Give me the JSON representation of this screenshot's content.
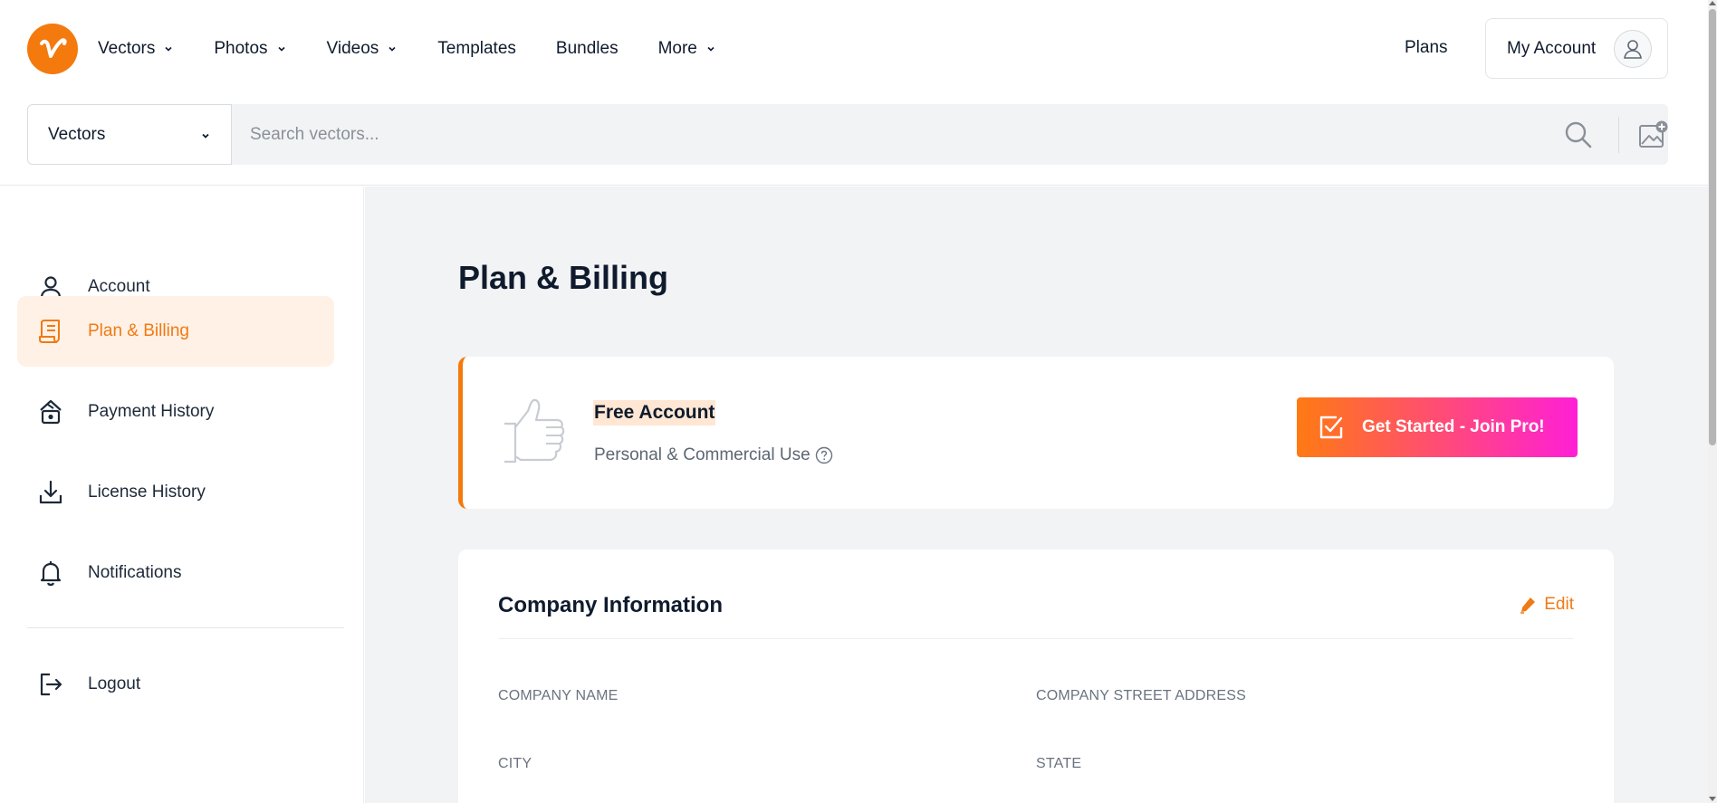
{
  "header": {
    "nav": [
      {
        "label": "Vectors",
        "has_dropdown": true
      },
      {
        "label": "Photos",
        "has_dropdown": true
      },
      {
        "label": "Videos",
        "has_dropdown": true
      },
      {
        "label": "Templates",
        "has_dropdown": false
      },
      {
        "label": "Bundles",
        "has_dropdown": false
      },
      {
        "label": "More",
        "has_dropdown": true
      }
    ],
    "plans_label": "Plans",
    "account_label": "My Account"
  },
  "search": {
    "category": "Vectors",
    "placeholder": "Search vectors...",
    "value": ""
  },
  "sidebar": {
    "items": [
      {
        "label": "Account",
        "icon": "user-icon",
        "active": false
      },
      {
        "label": "Plan & Billing",
        "icon": "receipt-icon",
        "active": true
      },
      {
        "label": "Payment History",
        "icon": "payment-history-icon",
        "active": false
      },
      {
        "label": "License History",
        "icon": "download-icon",
        "active": false
      },
      {
        "label": "Notifications",
        "icon": "bell-icon",
        "active": false
      }
    ],
    "logout_label": "Logout"
  },
  "main": {
    "title": "Plan & Billing",
    "plan": {
      "name": "Free Account",
      "subtitle": "Personal & Commercial Use",
      "cta_label": "Get Started - Join Pro!"
    },
    "company": {
      "title": "Company Information",
      "edit_label": "Edit",
      "fields": {
        "company_name": "COMPANY NAME",
        "company_street_address": "COMPANY STREET ADDRESS",
        "city": "CITY",
        "state": "STATE"
      }
    }
  },
  "colors": {
    "accent": "#f47a0e",
    "cta_gradient_start": "#ff7a12",
    "cta_gradient_end": "#ff1fd6",
    "active_bg": "#fff1e6",
    "main_bg": "#f2f3f5"
  }
}
